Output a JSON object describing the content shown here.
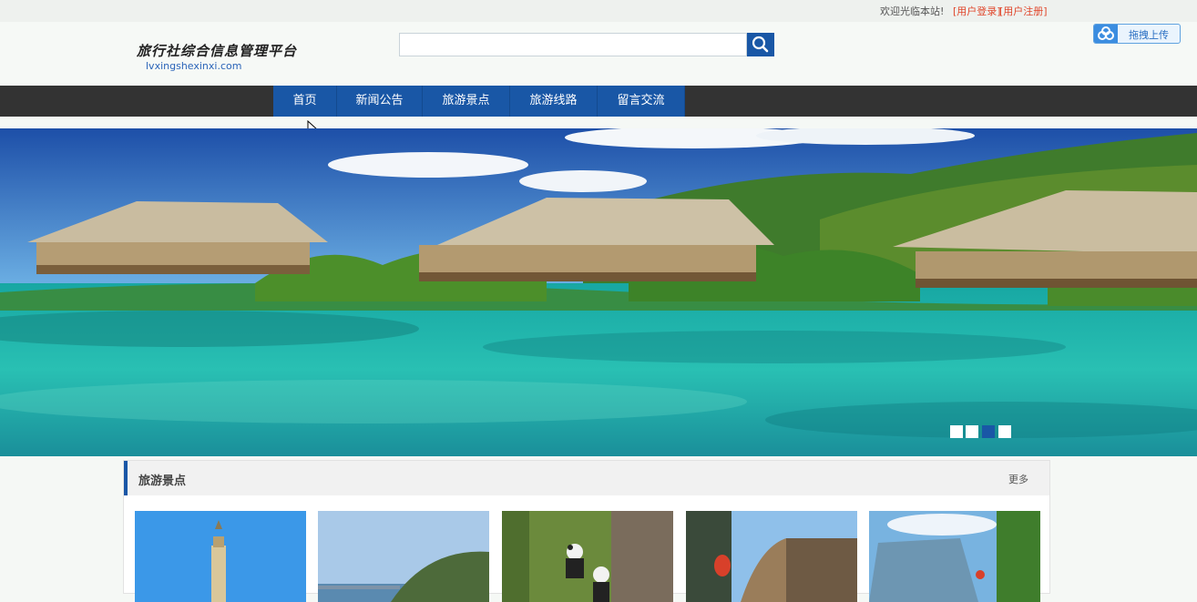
{
  "topbar": {
    "welcome": "欢迎光临本站!",
    "login_link": "[用户登录]",
    "register_link": "[用户注册]"
  },
  "header": {
    "logo_title": "旅行社综合信息管理平台",
    "logo_subtitle": "lvxingshexinxi.com",
    "search_placeholder": "",
    "search_icon": "search-icon",
    "upload_label": "拖拽上传",
    "upload_icon": "cloud-icon"
  },
  "nav": {
    "items": [
      {
        "label": "首页"
      },
      {
        "label": "新闻公告"
      },
      {
        "label": "旅游景点"
      },
      {
        "label": "旅游线路"
      },
      {
        "label": "留言交流"
      }
    ]
  },
  "banner": {
    "slide_count": 4,
    "active_slide": 3
  },
  "section": {
    "title": "旅游景点",
    "more": "更多",
    "thumbnails": [
      "lighthouse-photo",
      "coast-photo",
      "panda-photo",
      "old-town-photo",
      "cable-car-photo"
    ]
  },
  "colors": {
    "brand_blue": "#1957a6",
    "nav_bg": "#333333",
    "link_red": "#e0462b"
  }
}
